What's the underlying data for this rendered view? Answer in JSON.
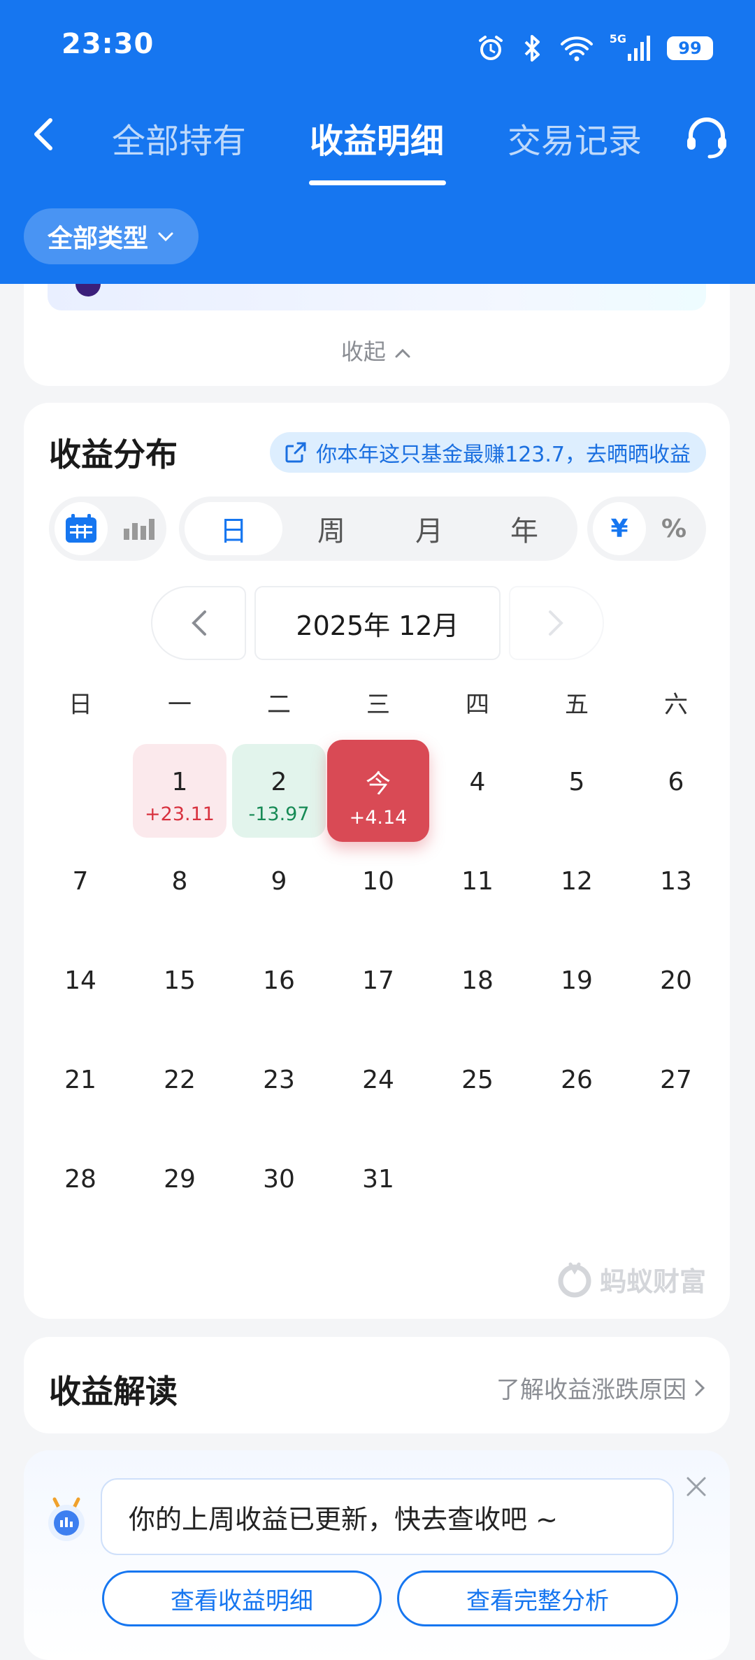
{
  "status": {
    "time": "23:30",
    "network": "5G",
    "battery": "99"
  },
  "nav": {
    "tabs": [
      {
        "label": "全部持有",
        "active": false
      },
      {
        "label": "收益明细",
        "active": true
      },
      {
        "label": "交易记录",
        "active": false
      }
    ]
  },
  "filter": {
    "label": "全部类型"
  },
  "collapse_label": "收起",
  "distribution": {
    "title": "收益分布",
    "share_text": "你本年这只基金最赚123.7，去晒晒收益",
    "periods": [
      {
        "label": "日",
        "active": true
      },
      {
        "label": "周",
        "active": false
      },
      {
        "label": "月",
        "active": false
      },
      {
        "label": "年",
        "active": false
      }
    ],
    "units": [
      {
        "label": "¥",
        "active": true
      },
      {
        "label": "%",
        "active": false
      }
    ],
    "month_label": "2025年 12月",
    "weekdays": [
      "日",
      "一",
      "二",
      "三",
      "四",
      "五",
      "六"
    ],
    "first_weekday_index": 1,
    "days_in_month": 31,
    "day_values": [
      {
        "day": "1",
        "value": "+23.11",
        "type": "up"
      },
      {
        "day": "2",
        "value": "-13.97",
        "type": "down"
      },
      {
        "day": "今",
        "value": "+4.14",
        "type": "today"
      }
    ],
    "watermark": "蚂蚁财富"
  },
  "interpretation": {
    "title": "收益解读",
    "link": "了解收益涨跌原因"
  },
  "notice": {
    "message": "你的上周收益已更新，快去查收吧 ~",
    "buttons": [
      "查看收益明细",
      "查看完整分析"
    ]
  },
  "colors": {
    "primary": "#1676f0",
    "up": "#d8323f",
    "down": "#168a55",
    "today_bg": "#d94a55"
  }
}
